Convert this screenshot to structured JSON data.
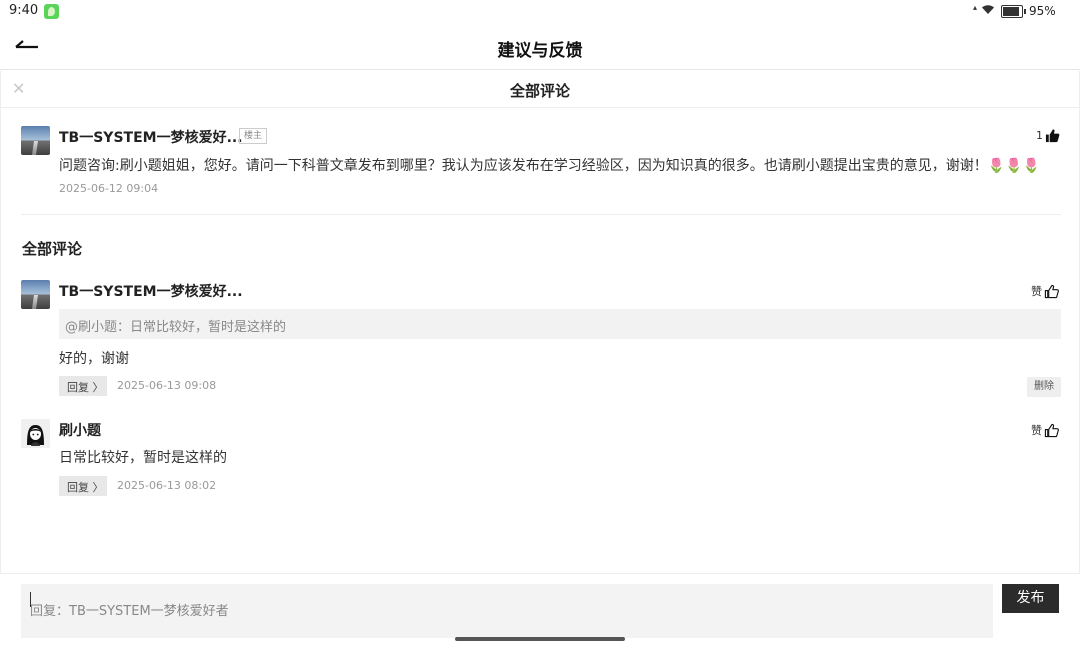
{
  "status_bar": {
    "time": "9:40",
    "battery": "95%",
    "battery_level": 0.95
  },
  "header": {
    "title": "建议与反馈"
  },
  "panel": {
    "title": "全部评论"
  },
  "post": {
    "user": "TB一SYSTEM一梦核爱好...",
    "tag": "楼主",
    "likes": "1",
    "content": "问题咨询:刷小题姐姐，您好。请问一下科普文章发布到哪里？我认为应该发布在学习经验区，因为知识真的很多。也请刷小题提出宝贵的意见，谢谢！🌷🌷🌷",
    "time": "2025-06-12 09:04"
  },
  "comments_section": {
    "title": "全部评论"
  },
  "comments": [
    {
      "user": "TB一SYSTEM一梦核爱好...",
      "like_label": "赞",
      "quote": "@刷小题：日常比较好，暂时是这样的",
      "text": "好的，谢谢",
      "reply_label": "回复 〉",
      "time": "2025-06-13 09:08",
      "delete_label": "删除"
    },
    {
      "user": "刷小题",
      "like_label": "赞",
      "text": "日常比较好，暂时是这样的",
      "reply_label": "回复 〉",
      "time": "2025-06-13 08:02"
    }
  ],
  "composer": {
    "placeholder": "回复：TB一SYSTEM一梦核爱好者",
    "publish_label": "发布"
  },
  "icons": {
    "back": "back-arrow-icon",
    "close": "close-icon",
    "like": "thumbs-up-icon",
    "wifi": "wifi-icon",
    "battery": "battery-icon",
    "notification": "app-notification-icon"
  }
}
